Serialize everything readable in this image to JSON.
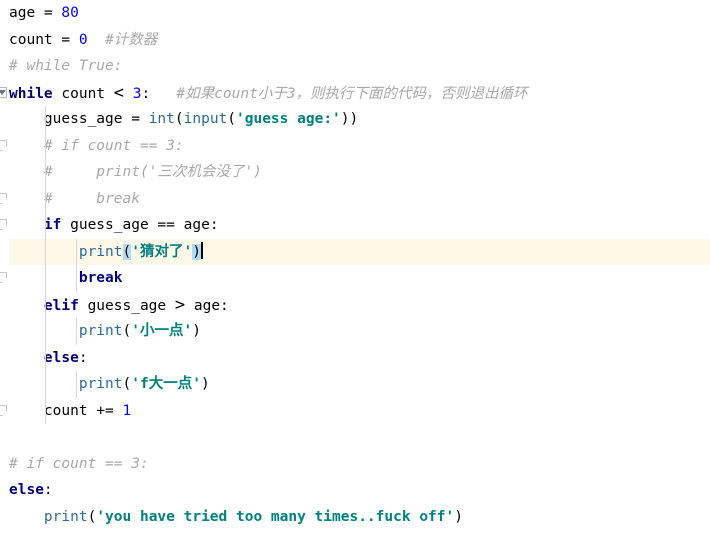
{
  "editor": {
    "name": "python-code-editor",
    "language": "Python",
    "current_line_number": 9,
    "colors": {
      "background": "#ffffff",
      "keyword": "#000080",
      "number": "#0000ff",
      "string": "#008080",
      "comment": "#a8a8a8",
      "builtin": "#2b6a9e",
      "plain_text": "#000000",
      "current_line_background": "#fdf8e8",
      "bracket_match_background": "#aedcf5",
      "indent_guide": "#d6d6d6",
      "fold_marker_border": "#c8c8c8"
    }
  },
  "lines": [
    {
      "n": 1,
      "text": "age = 80",
      "indent": 0,
      "tokens": [
        {
          "t": "age ",
          "k": "pl"
        },
        {
          "t": "= ",
          "k": "op"
        },
        {
          "t": "80",
          "k": "num"
        }
      ]
    },
    {
      "n": 2,
      "text": "count = 0  #计数器",
      "indent": 0,
      "tokens": [
        {
          "t": "count ",
          "k": "pl"
        },
        {
          "t": "= ",
          "k": "op"
        },
        {
          "t": "0",
          "k": "num"
        },
        {
          "t": "  ",
          "k": "pl"
        },
        {
          "t": "#计数器",
          "k": "cmt"
        }
      ]
    },
    {
      "n": 3,
      "text": "# while True:",
      "indent": 0,
      "tokens": [
        {
          "t": "# while True:",
          "k": "cmt"
        }
      ]
    },
    {
      "n": 4,
      "text": "while count < 3:   #如果count小于3，则执行下面的代码，否则退出循环",
      "indent": 0,
      "fold": "arrow",
      "tokens": [
        {
          "t": "while",
          "k": "kw"
        },
        {
          "t": " count ",
          "k": "pl"
        },
        {
          "t": "<",
          "k": "gt"
        },
        {
          "t": " ",
          "k": "pl"
        },
        {
          "t": "3",
          "k": "num"
        },
        {
          "t": ":",
          "k": "pl"
        },
        {
          "t": "   ",
          "k": "pl"
        },
        {
          "t": "#如果count小于3，则执行下面的代码，否则退出循环",
          "k": "cmt"
        }
      ]
    },
    {
      "n": 5,
      "text": "    guess_age = int(input('guess age:'))",
      "indent": 1,
      "tokens": [
        {
          "t": "    guess_age ",
          "k": "pl"
        },
        {
          "t": "= ",
          "k": "op"
        },
        {
          "t": "int",
          "k": "bi"
        },
        {
          "t": "(",
          "k": "pl"
        },
        {
          "t": "input",
          "k": "bi"
        },
        {
          "t": "(",
          "k": "pl"
        },
        {
          "t": "'guess age:'",
          "k": "str"
        },
        {
          "t": "))",
          "k": "pl"
        }
      ]
    },
    {
      "n": 6,
      "text": "    # if count == 3:",
      "indent": 1,
      "fold": "dogear",
      "tokens": [
        {
          "t": "    ",
          "k": "pl"
        },
        {
          "t": "# if count == 3:",
          "k": "cmt"
        }
      ]
    },
    {
      "n": 7,
      "text": "    #     print('三次机会没了')",
      "indent": 1,
      "tokens": [
        {
          "t": "    ",
          "k": "pl"
        },
        {
          "t": "#     print('三次机会没了')",
          "k": "cmt"
        }
      ]
    },
    {
      "n": 8,
      "text": "    #     break",
      "indent": 1,
      "fold": "dogear",
      "tokens": [
        {
          "t": "    ",
          "k": "pl"
        },
        {
          "t": "#     break",
          "k": "cmt"
        }
      ]
    },
    {
      "n": 9,
      "text": "    if guess_age == age:",
      "indent": 1,
      "fold": "dogear",
      "tokens": [
        {
          "t": "    ",
          "k": "pl"
        },
        {
          "t": "if",
          "k": "kw"
        },
        {
          "t": " guess_age ",
          "k": "pl"
        },
        {
          "t": "== ",
          "k": "op"
        },
        {
          "t": "age:",
          "k": "pl"
        }
      ]
    },
    {
      "n": 10,
      "text": "        print('猜对了')",
      "indent": 2,
      "current": true,
      "caret": true,
      "tokens": [
        {
          "t": "        ",
          "k": "pl"
        },
        {
          "t": "print",
          "k": "fn"
        },
        {
          "t": "(",
          "k": "brk"
        },
        {
          "t": "'猜对了'",
          "k": "str"
        },
        {
          "t": ")",
          "k": "brk"
        }
      ]
    },
    {
      "n": 11,
      "text": "        break",
      "indent": 2,
      "fold": "dogear",
      "tokens": [
        {
          "t": "        ",
          "k": "pl"
        },
        {
          "t": "break",
          "k": "kw"
        }
      ]
    },
    {
      "n": 12,
      "text": "    elif guess_age > age:",
      "indent": 1,
      "tokens": [
        {
          "t": "    ",
          "k": "pl"
        },
        {
          "t": "elif",
          "k": "kw"
        },
        {
          "t": " guess_age ",
          "k": "pl"
        },
        {
          "t": ">",
          "k": "gt"
        },
        {
          "t": " age:",
          "k": "pl"
        }
      ]
    },
    {
      "n": 13,
      "text": "        print('小一点')",
      "indent": 2,
      "tokens": [
        {
          "t": "        ",
          "k": "pl"
        },
        {
          "t": "print",
          "k": "fn"
        },
        {
          "t": "(",
          "k": "pl"
        },
        {
          "t": "'小一点'",
          "k": "str"
        },
        {
          "t": ")",
          "k": "pl"
        }
      ]
    },
    {
      "n": 14,
      "text": "    else:",
      "indent": 1,
      "tokens": [
        {
          "t": "    ",
          "k": "pl"
        },
        {
          "t": "else",
          "k": "kw"
        },
        {
          "t": ":",
          "k": "pl"
        }
      ]
    },
    {
      "n": 15,
      "text": "        print('f大一点')",
      "indent": 2,
      "tokens": [
        {
          "t": "        ",
          "k": "pl"
        },
        {
          "t": "print",
          "k": "fn"
        },
        {
          "t": "(",
          "k": "pl"
        },
        {
          "t": "'f大一点'",
          "k": "str"
        },
        {
          "t": ")",
          "k": "pl"
        }
      ]
    },
    {
      "n": 16,
      "text": "    count += 1",
      "indent": 1,
      "fold": "dogear",
      "tokens": [
        {
          "t": "    count ",
          "k": "pl"
        },
        {
          "t": "+= ",
          "k": "op"
        },
        {
          "t": "1",
          "k": "num"
        }
      ]
    },
    {
      "n": 17,
      "text": "",
      "indent": 0,
      "tokens": []
    },
    {
      "n": 18,
      "text": "# if count == 3:",
      "indent": 0,
      "tokens": [
        {
          "t": "# if count == 3:",
          "k": "cmt"
        }
      ]
    },
    {
      "n": 19,
      "text": "else:",
      "indent": 0,
      "tokens": [
        {
          "t": "else",
          "k": "kw"
        },
        {
          "t": ":",
          "k": "pl"
        }
      ]
    },
    {
      "n": 20,
      "text": "    print('you have tried too many times..fuck off')",
      "indent": 0,
      "tokens": [
        {
          "t": "    ",
          "k": "pl"
        },
        {
          "t": "print",
          "k": "fn"
        },
        {
          "t": "(",
          "k": "pl"
        },
        {
          "t": "'you have tried too many times..fuck off'",
          "k": "str"
        },
        {
          "t": ")",
          "k": "pl"
        }
      ]
    }
  ]
}
